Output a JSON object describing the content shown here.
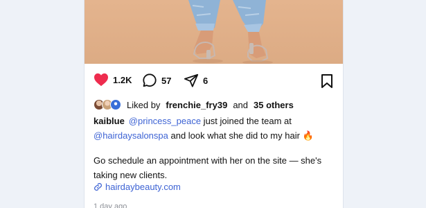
{
  "post": {
    "like_count": "1.2K",
    "comment_count": "57",
    "share_count": "6",
    "liked_by_prefix": "Liked by",
    "liked_by_user": "frenchie_fry39",
    "liked_by_joiner": "and",
    "liked_by_others": "35 others",
    "caption_user": "kaiblue",
    "mention_1": "@princess_peace",
    "caption_text_1": " just joined the team at ",
    "mention_2": "@hairdaysalonspa",
    "caption_text_2": " and look what she did to my hair 🔥",
    "caption_para_2": "Go schedule an appointment with her on the site — she's taking new clients.",
    "link_text": "hairdaybeauty.com",
    "timestamp": "1 day ago"
  },
  "icons": {
    "like": "heart-icon",
    "comment": "comment-icon",
    "share": "send-icon",
    "save": "bookmark-icon",
    "link": "link-icon"
  },
  "colors": {
    "heart": "#ee2c4e",
    "mention": "#3d63d4",
    "photo_background": "#e0b089"
  }
}
